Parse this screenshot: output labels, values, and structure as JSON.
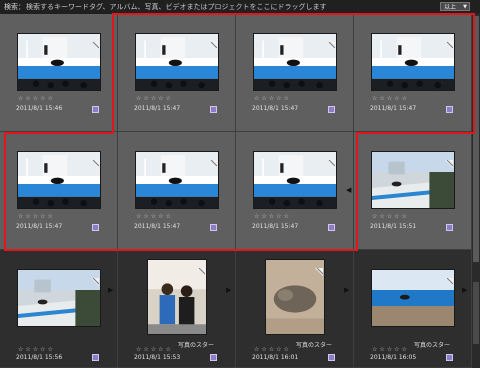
{
  "search_bar": {
    "label": "検索：",
    "hint": "検索するキーワードタグ、アルバム、写真、ビデオまたはプロジェクトをここにドラッグします",
    "sort_value": "以上"
  },
  "rating_stars": "☆☆☆☆☆",
  "thumbnails": [
    {
      "date": "2011/8/1 15:46",
      "kind": "show"
    },
    {
      "date": "2011/8/1 15:47",
      "kind": "show"
    },
    {
      "date": "2011/8/1 15:47",
      "kind": "show"
    },
    {
      "date": "2011/8/1 15:47",
      "kind": "show"
    },
    {
      "date": "2011/8/1 15:47",
      "kind": "show"
    },
    {
      "date": "2011/8/1 15:47",
      "kind": "show"
    },
    {
      "date": "2011/8/1 15:47",
      "kind": "show"
    },
    {
      "date": "2011/8/1 15:51",
      "kind": "stands"
    },
    {
      "date": "2011/8/1 15:56",
      "kind": "stands2"
    },
    {
      "date": "2011/8/1 15:53",
      "kind": "people",
      "caption": "写真のスター"
    },
    {
      "date": "2011/8/1 16:01",
      "kind": "seal",
      "caption": "写真のスター"
    },
    {
      "date": "2011/8/1 16:05",
      "kind": "pool",
      "caption": "写真のスター"
    }
  ],
  "colors": {
    "selection_border": "#e0181d",
    "tag_icon": "#8e7cc8"
  }
}
